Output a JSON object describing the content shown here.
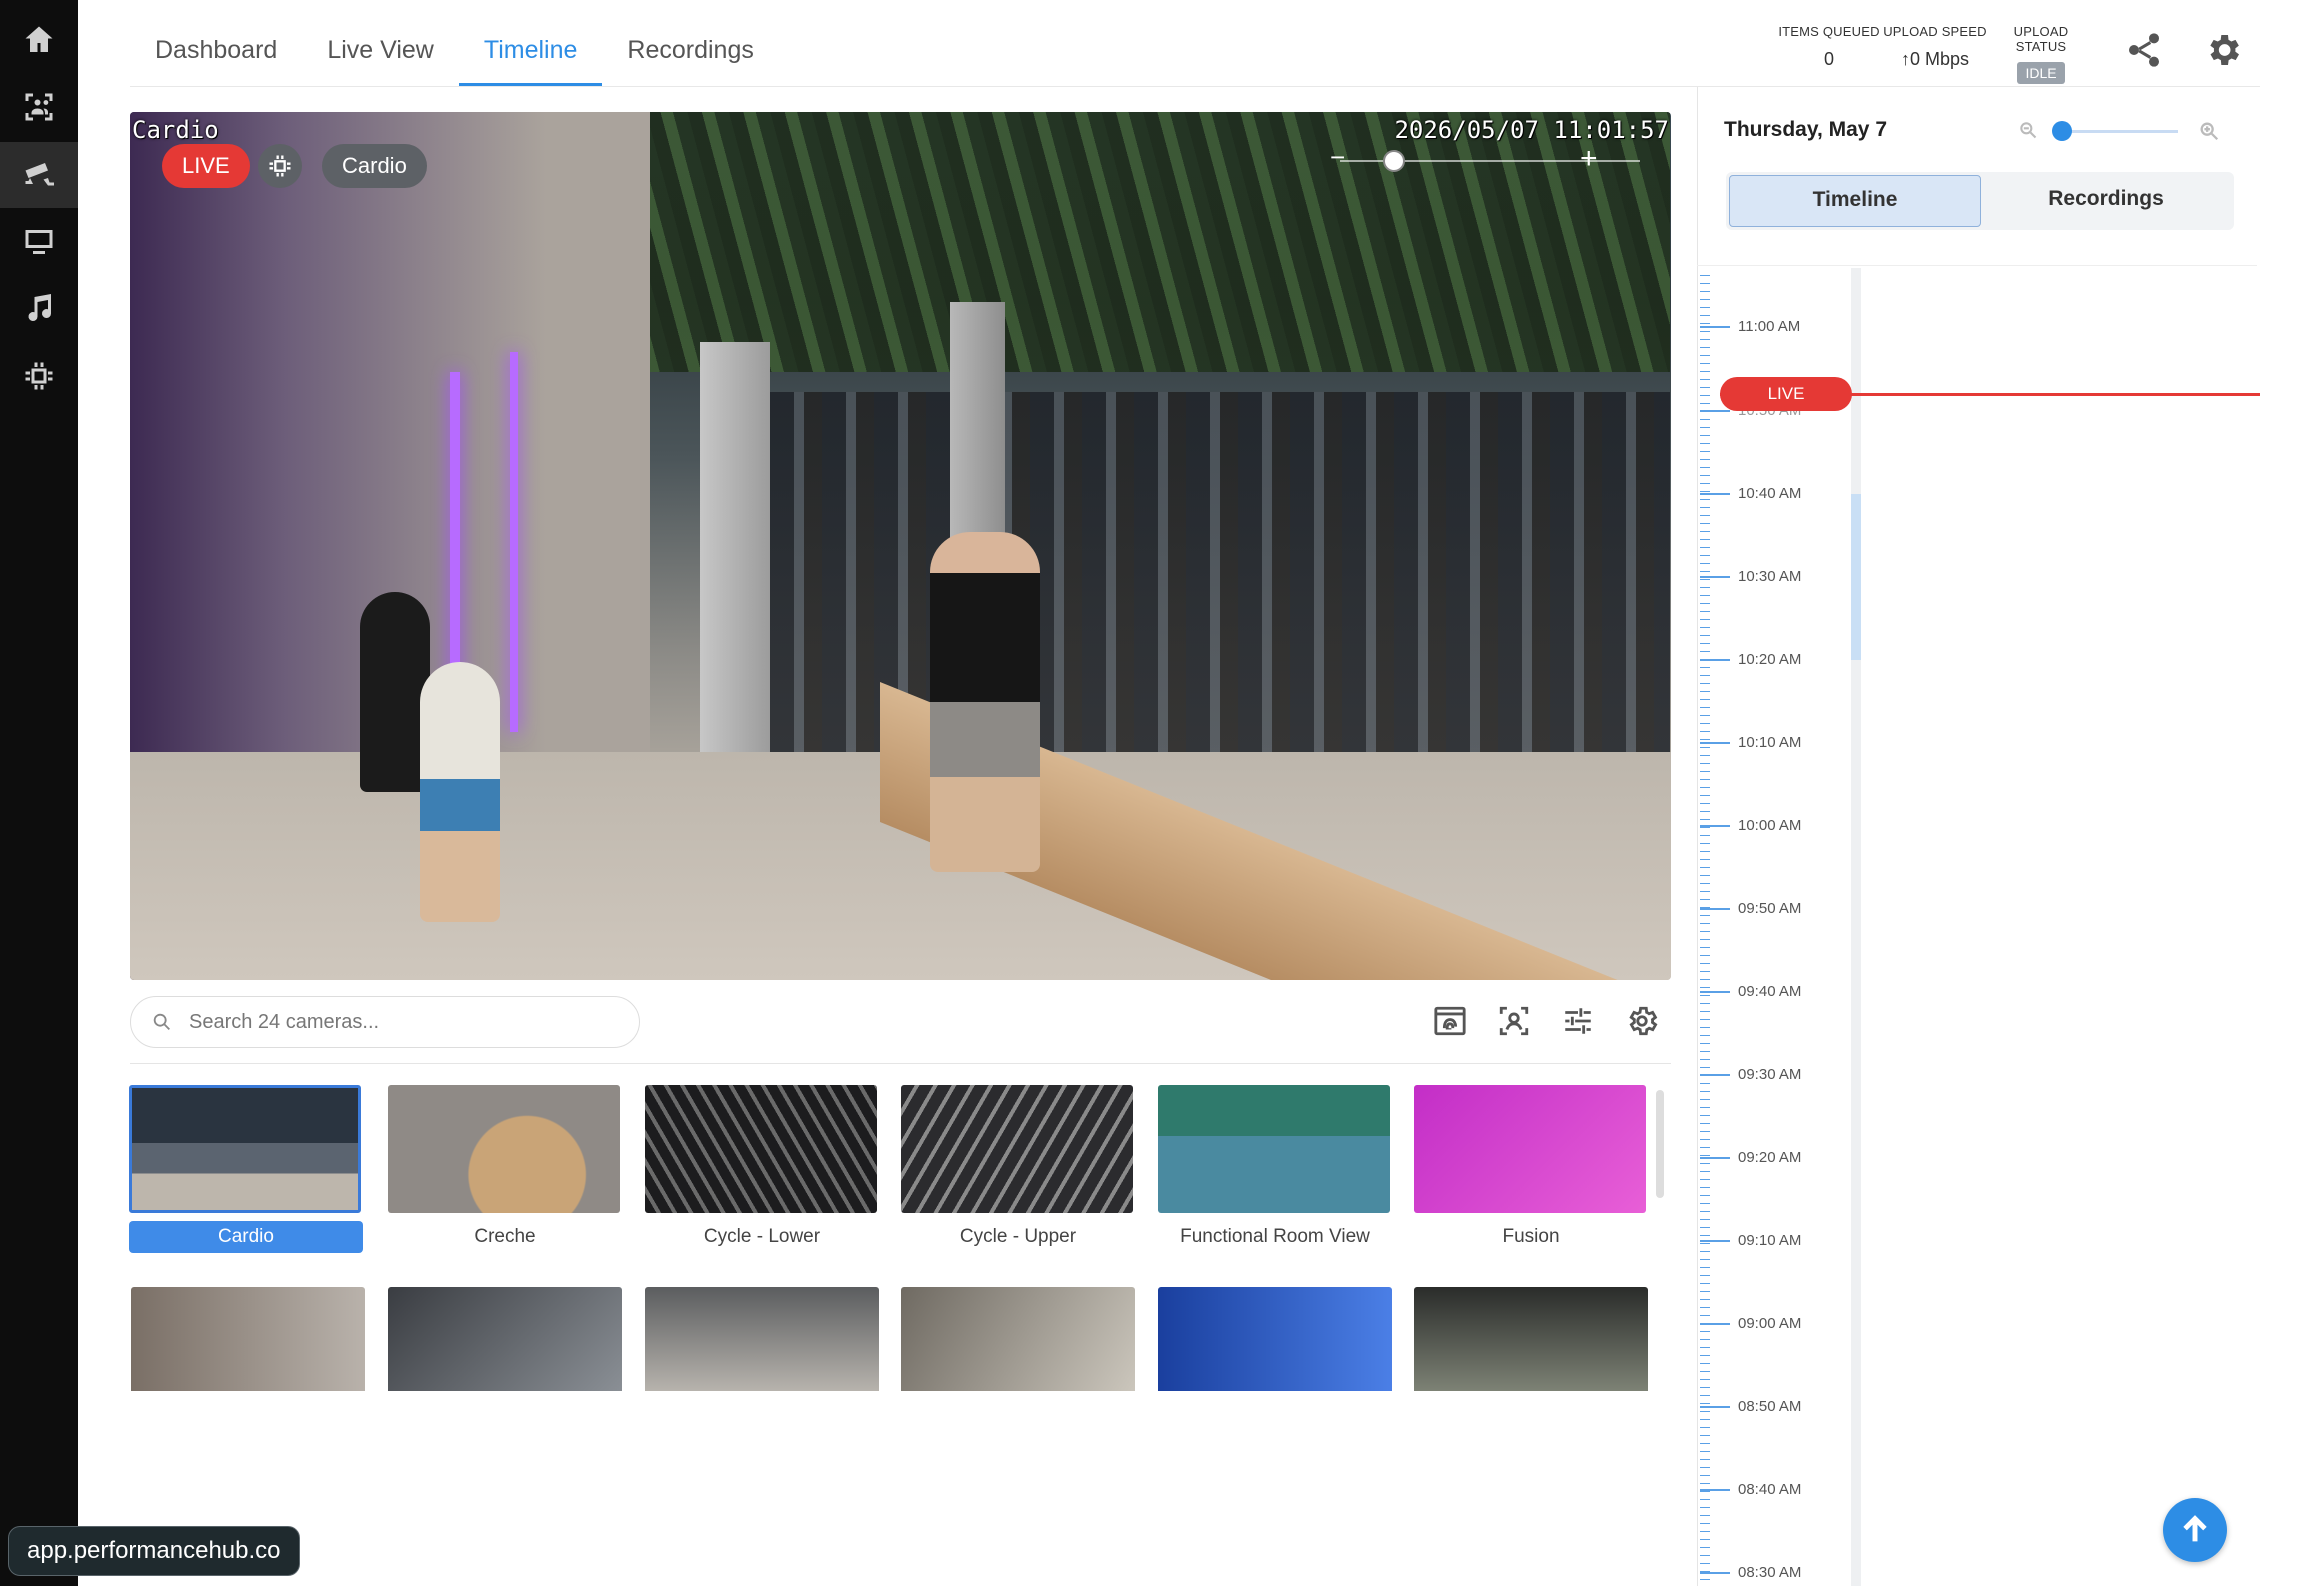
{
  "nav": {
    "tabs": [
      {
        "label": "Dashboard",
        "active": false
      },
      {
        "label": "Live View",
        "active": false
      },
      {
        "label": "Timeline",
        "active": true
      },
      {
        "label": "Recordings",
        "active": false
      }
    ]
  },
  "sidebar": {
    "items": [
      {
        "icon": "home-icon"
      },
      {
        "icon": "people-scan-icon"
      },
      {
        "icon": "security-camera-icon",
        "active": true
      },
      {
        "icon": "monitor-icon"
      },
      {
        "icon": "music-icon"
      },
      {
        "icon": "chip-icon"
      }
    ]
  },
  "stats": {
    "items_queued_label": "ITEMS QUEUED",
    "items_queued_value": "0",
    "upload_speed_label": "UPLOAD SPEED",
    "upload_speed_value": "↑0 Mbps",
    "upload_status_label": "UPLOAD STATUS",
    "upload_status_value": "IDLE"
  },
  "player": {
    "camera_overlay": "Cardio",
    "timestamp": "2026/05/07 11:01:57",
    "live_label": "LIVE",
    "camera_pill": "Cardio",
    "zoom_minus": "−",
    "zoom_plus": "+"
  },
  "search": {
    "placeholder": "Search 24 cameras..."
  },
  "cameras": [
    {
      "name": "Cardio",
      "selected": true,
      "colors": [
        "#2a3440",
        "#bdb6ac"
      ]
    },
    {
      "name": "Creche",
      "selected": false,
      "colors": [
        "#8f8a86",
        "#c9a477"
      ]
    },
    {
      "name": "Cycle - Lower",
      "selected": false,
      "colors": [
        "#1c1c1e",
        "#6a6a6a"
      ]
    },
    {
      "name": "Cycle - Upper",
      "selected": false,
      "colors": [
        "#2b2b2e",
        "#8a8a8a"
      ]
    },
    {
      "name": "Functional Room View",
      "selected": false,
      "colors": [
        "#2f7a6c",
        "#4a8aa0"
      ]
    },
    {
      "name": "Fusion",
      "selected": false,
      "colors": [
        "#c32ec7",
        "#e85fd7"
      ]
    }
  ],
  "cameras_row2_colors": [
    [
      "#7a6f66",
      "#b9b2ab"
    ],
    [
      "#3a3d42",
      "#8a8f95"
    ],
    [
      "#5b5d5f",
      "#b7b3ad"
    ],
    [
      "#6f6a62",
      "#cbc6bc"
    ],
    [
      "#1a3f9e",
      "#4b7fe6"
    ],
    [
      "#2a2c2a",
      "#7d8275"
    ]
  ],
  "timeline": {
    "date": "Thursday, May 7",
    "toggle_timeline": "Timeline",
    "toggle_recordings": "Recordings",
    "live_label": "LIVE",
    "hidden_label": "10:50 AM",
    "times": [
      "11:00 AM",
      "10:40 AM",
      "10:30 AM",
      "10:20 AM",
      "10:10 AM",
      "10:00 AM",
      "09:50 AM",
      "09:40 AM",
      "09:30 AM",
      "09:20 AM",
      "09:10 AM",
      "09:00 AM",
      "08:50 AM",
      "08:40 AM",
      "08:30 AM"
    ]
  },
  "browser": {
    "url": "app.performancehub.co"
  },
  "colors": {
    "accent": "#2d8de5",
    "live": "#e53935",
    "rail": "#0d0d0d"
  }
}
